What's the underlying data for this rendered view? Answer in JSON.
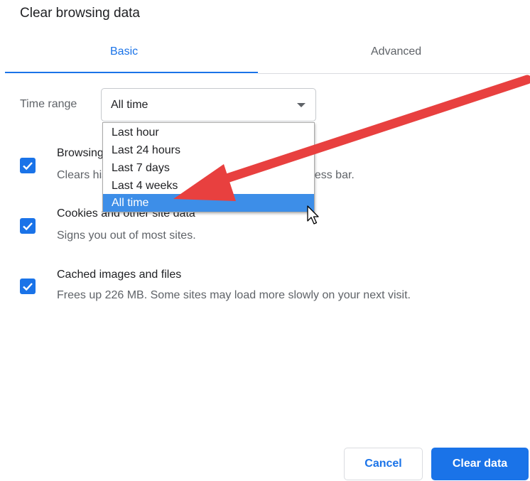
{
  "dialog": {
    "title": "Clear browsing data"
  },
  "tabs": [
    {
      "label": "Basic",
      "active": true
    },
    {
      "label": "Advanced",
      "active": false
    }
  ],
  "time_range": {
    "label": "Time range",
    "selected": "All time",
    "options": [
      "Last hour",
      "Last 24 hours",
      "Last 7 days",
      "Last 4 weeks",
      "All time"
    ],
    "highlighted": "All time"
  },
  "items": [
    {
      "title": "Browsing history",
      "description": "Clears history from all synced devices and the address bar.",
      "checked": true
    },
    {
      "title": "Cookies and other site data",
      "description": "Signs you out of most sites.",
      "checked": true
    },
    {
      "title": "Cached images and files",
      "description": "Frees up 226 MB. Some sites may load more slowly on your next visit.",
      "checked": true
    }
  ],
  "buttons": {
    "cancel": "Cancel",
    "clear": "Clear data"
  },
  "colors": {
    "accent": "#1a73e8",
    "selected_option": "#3d8ee8",
    "annotation_arrow": "#e8403f"
  },
  "icons": {
    "checkbox": "checkmark-icon",
    "dropdown": "chevron-down-icon",
    "pointer": "mouse-cursor-icon",
    "annotation": "red-arrow-annotation"
  }
}
